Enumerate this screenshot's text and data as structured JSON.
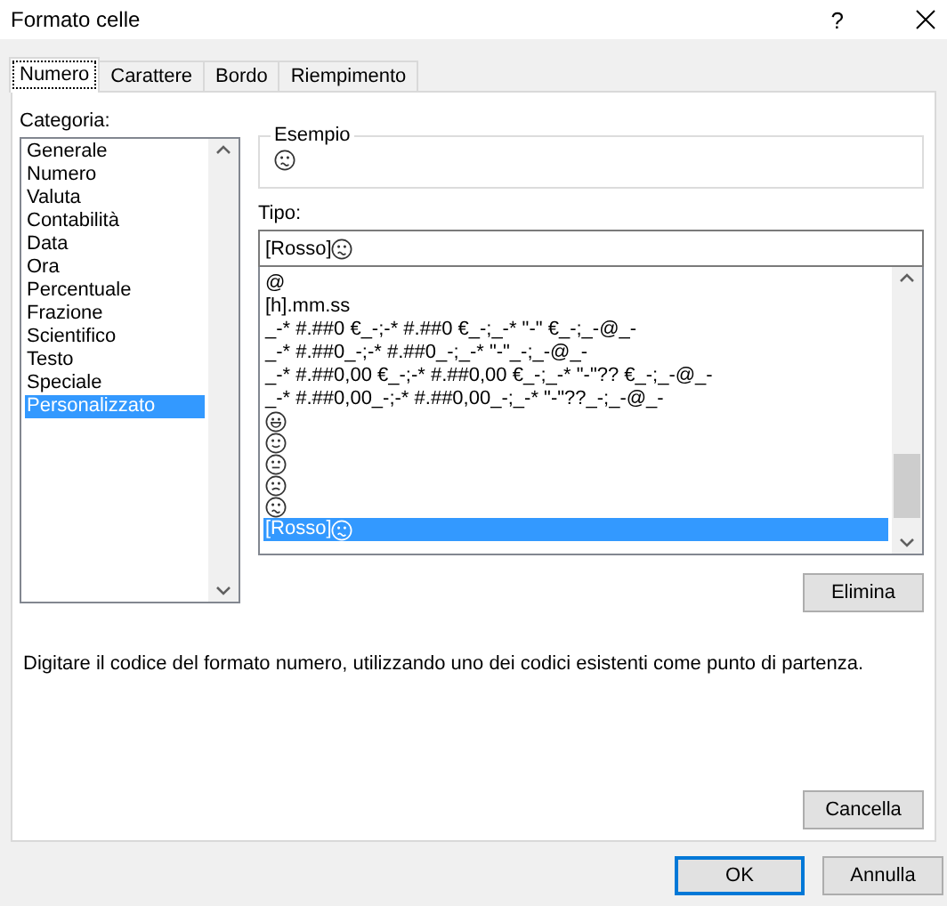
{
  "window": {
    "title": "Formato celle",
    "help": "?"
  },
  "tabs": [
    {
      "label": "Numero",
      "selected": true
    },
    {
      "label": "Carattere",
      "selected": false
    },
    {
      "label": "Bordo",
      "selected": false
    },
    {
      "label": "Riempimento",
      "selected": false
    }
  ],
  "category": {
    "label": "Categoria:",
    "items": [
      {
        "label": "Generale",
        "selected": false
      },
      {
        "label": "Numero",
        "selected": false
      },
      {
        "label": "Valuta",
        "selected": false
      },
      {
        "label": "Contabilità",
        "selected": false
      },
      {
        "label": "Data",
        "selected": false
      },
      {
        "label": "Ora",
        "selected": false
      },
      {
        "label": "Percentuale",
        "selected": false
      },
      {
        "label": "Frazione",
        "selected": false
      },
      {
        "label": "Scientifico",
        "selected": false
      },
      {
        "label": "Testo",
        "selected": false
      },
      {
        "label": "Speciale",
        "selected": false
      },
      {
        "label": "Personalizzato",
        "selected": true
      }
    ]
  },
  "sample": {
    "label": "Esempio",
    "kind": "frown"
  },
  "type": {
    "label": "Tipo:",
    "value": "[Rosso]",
    "kind": "frown",
    "items": [
      {
        "text": "@",
        "selected": false
      },
      {
        "text": "[h].mm.ss",
        "selected": false
      },
      {
        "text": "_-* #.##0 €_-;-* #.##0 €_-;_-* \"-\" €_-;_-@_-",
        "selected": false
      },
      {
        "text": "_-* #.##0_-;-* #.##0_-;_-* \"-\"_-;_-@_-",
        "selected": false
      },
      {
        "text": "_-* #.##0,00 €_-;-* #.##0,00 €_-;_-* \"-\"?? €_-;_-@_-",
        "selected": false
      },
      {
        "text": "_-* #.##0,00_-;-* #.##0,00_-;_-* \"-\"??_-;_-@_-",
        "selected": false
      },
      {
        "kind": "grin",
        "selected": false
      },
      {
        "kind": "smile",
        "selected": false
      },
      {
        "kind": "neutral",
        "selected": false
      },
      {
        "kind": "confused",
        "selected": false
      },
      {
        "kind": "frown",
        "selected": false
      },
      {
        "text": "[Rosso]",
        "kind": "frown",
        "selected": true
      }
    ]
  },
  "delete_button": "Elimina",
  "description": "Digitare il codice del formato numero, utilizzando uno dei codici esistenti come punto di partenza.",
  "clear_button": "Cancella",
  "buttons": [
    {
      "label": "OK",
      "default": true
    },
    {
      "label": "Annulla",
      "default": false
    }
  ]
}
